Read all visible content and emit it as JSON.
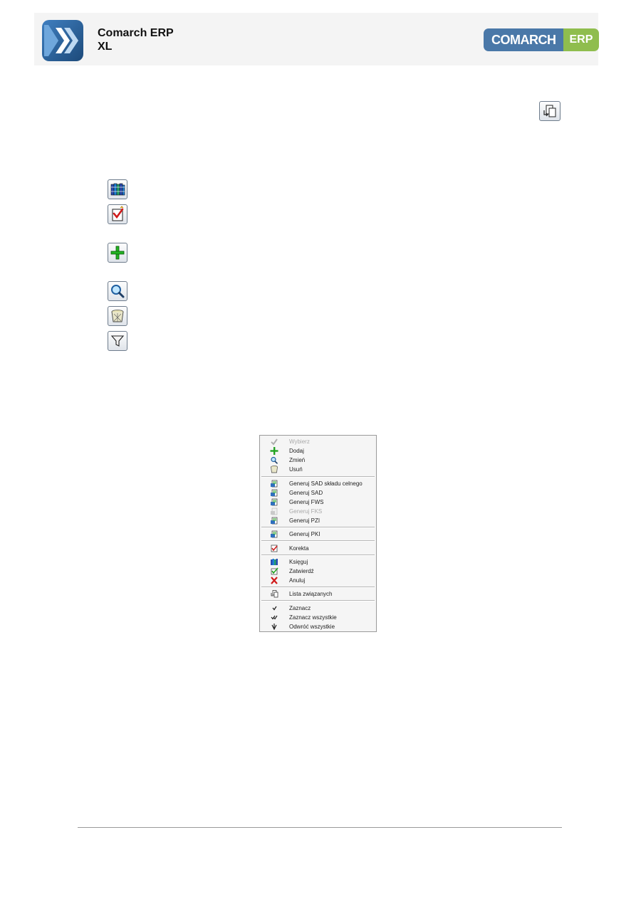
{
  "header": {
    "product_title_line1": "Comarch ERP",
    "product_title_line2": "XL",
    "brand_left": "COMARCH",
    "brand_right": "ERP"
  },
  "icons": [
    "related-documents-icon",
    "book-ledger-icon",
    "approve-document-icon",
    "add-icon",
    "magnifier-icon",
    "delete-basket-icon",
    "filter-icon"
  ],
  "context_menu": {
    "groups": [
      [
        {
          "label": "Wybierz",
          "icon": "checkmark-icon",
          "disabled": true
        },
        {
          "label": "Dodaj",
          "icon": "add-icon",
          "disabled": false
        },
        {
          "label": "Zmień",
          "icon": "magnifier-icon",
          "disabled": false
        },
        {
          "label": "Usuń",
          "icon": "delete-basket-icon",
          "disabled": false
        }
      ],
      [
        {
          "label": "Generuj SAD składu celnego",
          "icon": "generate-document-icon",
          "disabled": false
        },
        {
          "label": "Generuj SAD",
          "icon": "generate-document-icon",
          "disabled": false
        },
        {
          "label": "Generuj FWS",
          "icon": "generate-document-icon",
          "disabled": false
        },
        {
          "label": "Generuj FKS",
          "icon": "generate-document-icon",
          "disabled": true
        },
        {
          "label": "Generuj PZI",
          "icon": "generate-document-icon",
          "disabled": false
        }
      ],
      [
        {
          "label": "Generuj PKI",
          "icon": "generate-document-icon",
          "disabled": false
        }
      ],
      [
        {
          "label": "Korekta",
          "icon": "correction-icon",
          "disabled": false
        }
      ],
      [
        {
          "label": "Księguj",
          "icon": "book-ledger-icon",
          "disabled": false
        },
        {
          "label": "Zatwierdź",
          "icon": "approve-icon",
          "disabled": false
        },
        {
          "label": "Anuluj",
          "icon": "cancel-icon",
          "disabled": false
        }
      ],
      [
        {
          "label": "Lista związanych",
          "icon": "related-documents-icon",
          "disabled": false
        }
      ],
      [
        {
          "label": "Zaznacz",
          "icon": "tick-icon",
          "disabled": false
        },
        {
          "label": "Zaznacz wszystkie",
          "icon": "double-tick-icon",
          "disabled": false
        },
        {
          "label": "Odwróć wszystkie",
          "icon": "invert-tick-icon",
          "disabled": false
        }
      ]
    ]
  }
}
